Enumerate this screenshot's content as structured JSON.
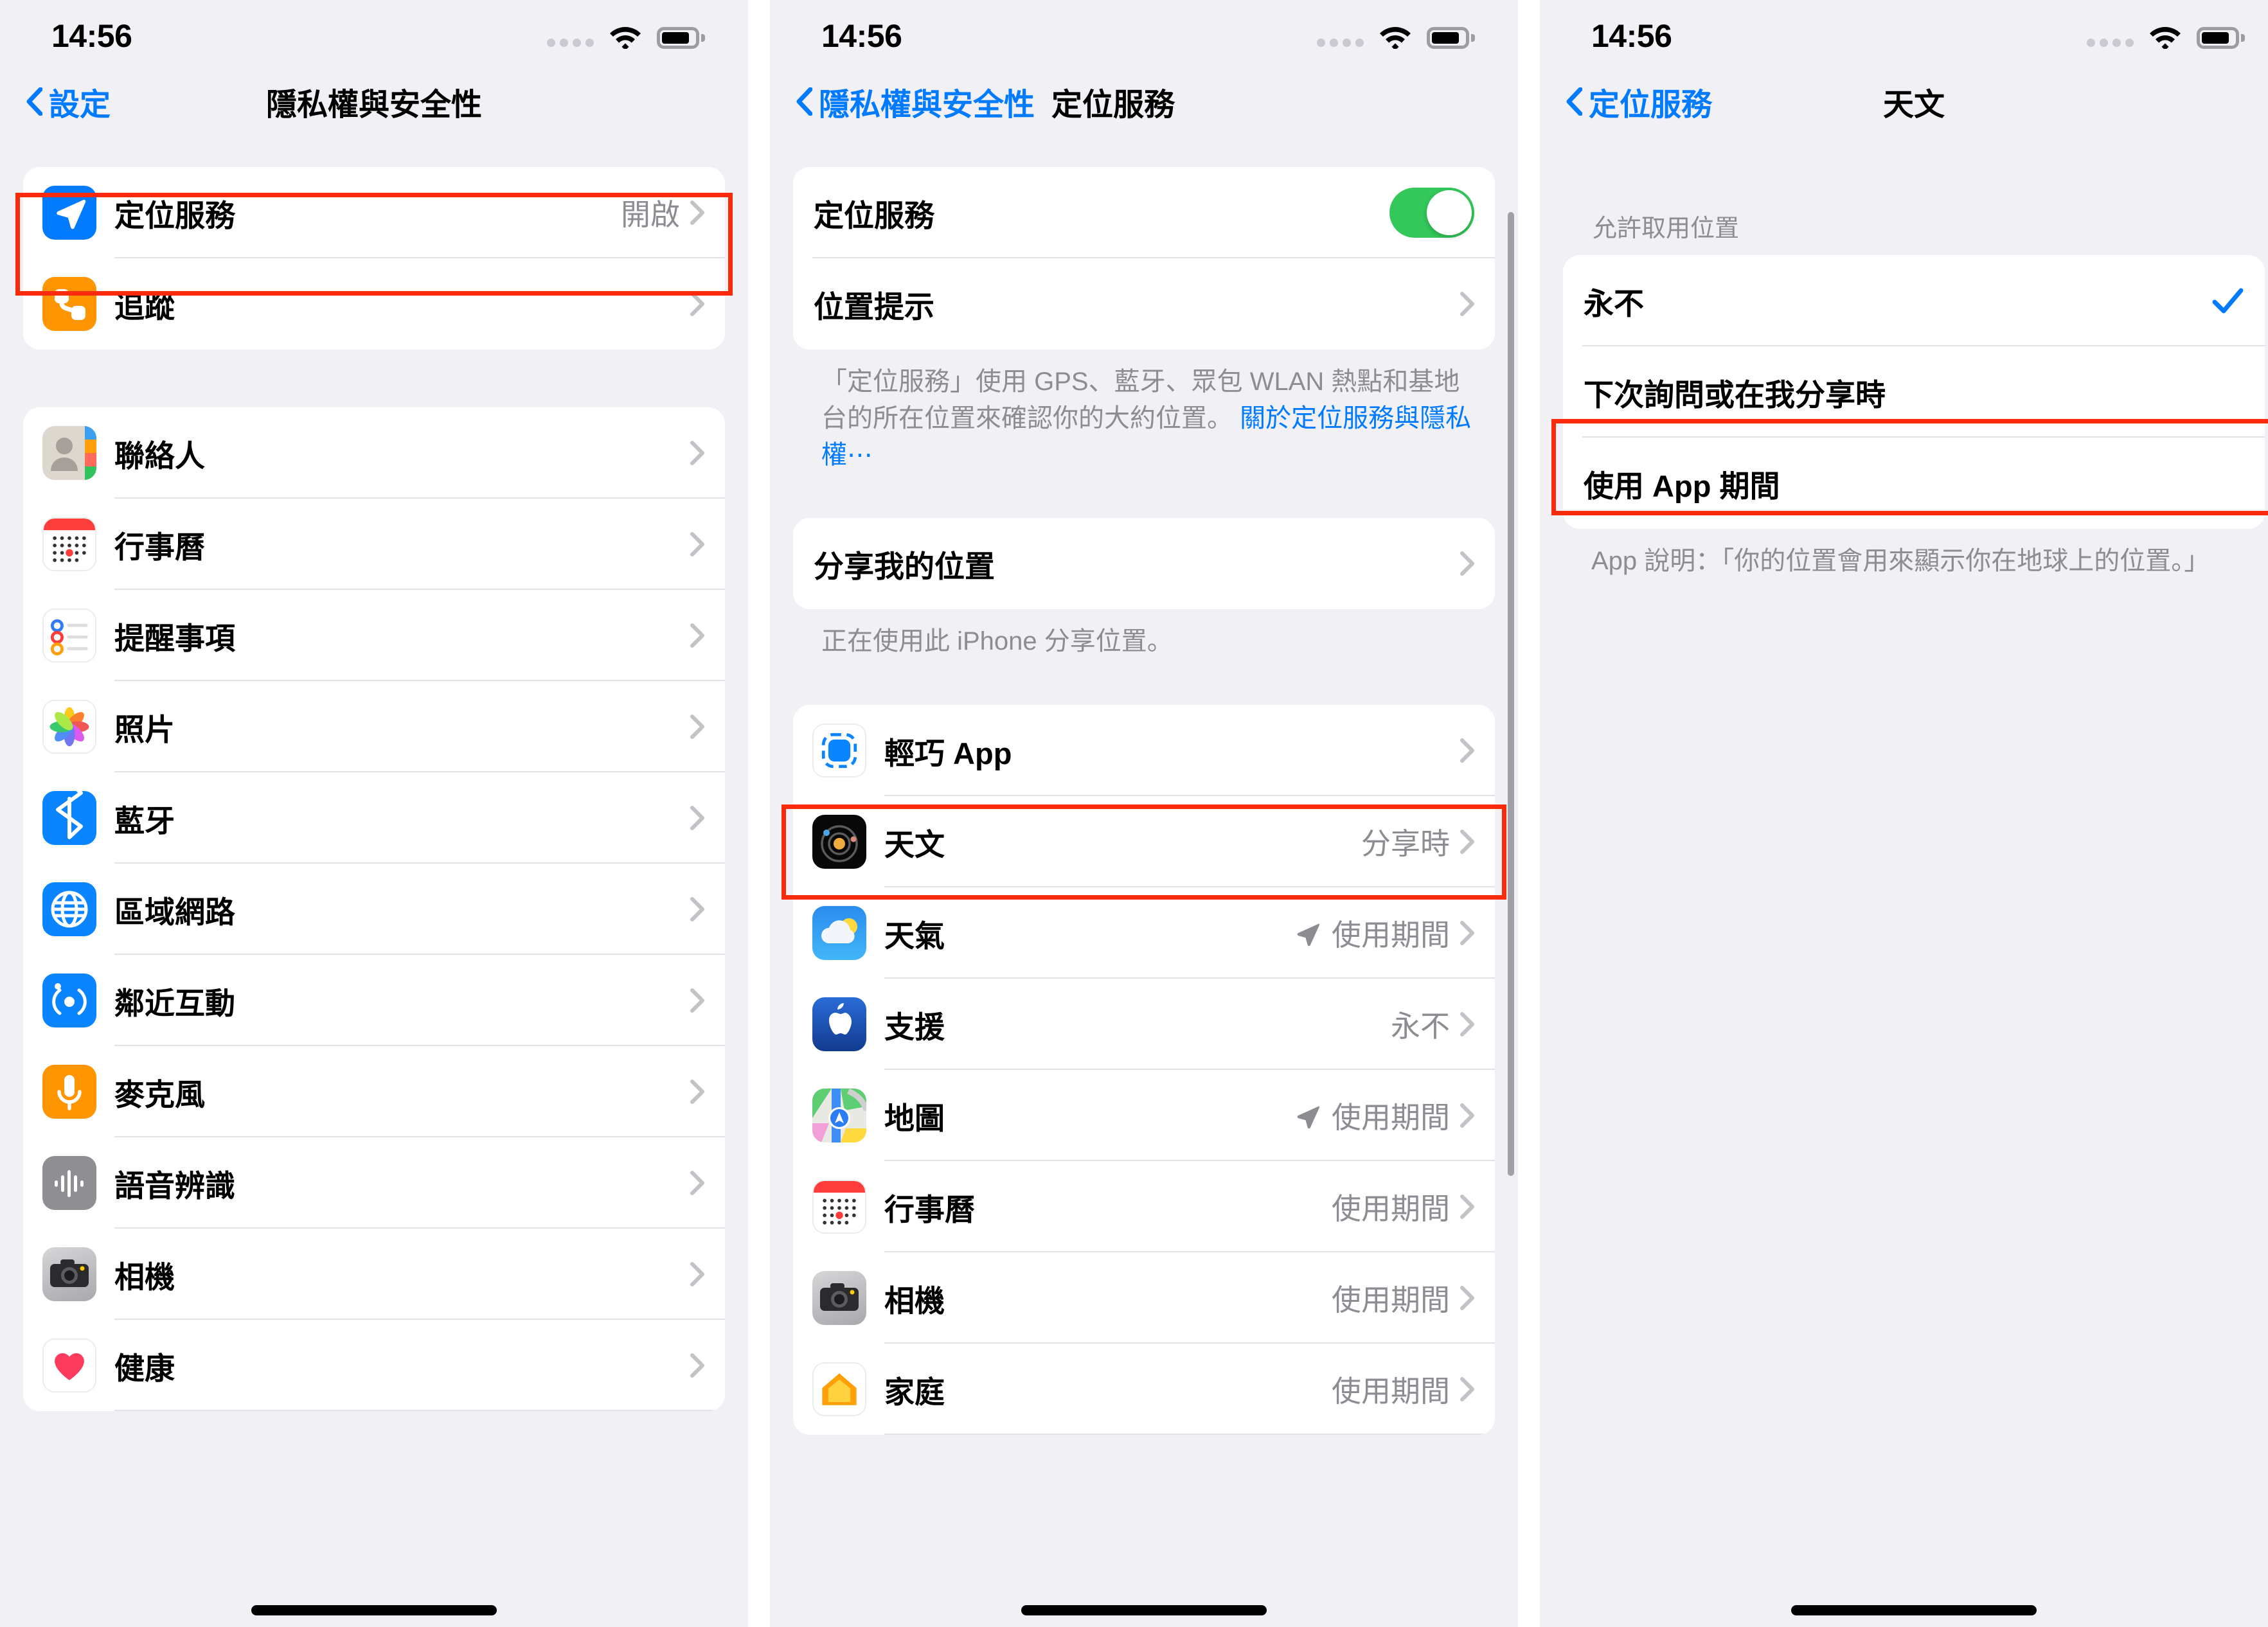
{
  "statusbar": {
    "time": "14:56"
  },
  "panel1": {
    "nav": {
      "back_label": "設定",
      "title": "隱私權與安全性"
    },
    "group_a": [
      {
        "label": "定位服務",
        "value": "開啟",
        "icon": "location-services-icon",
        "highlighted": true
      },
      {
        "label": "追蹤",
        "value": "",
        "icon": "tracking-icon",
        "highlighted": false
      }
    ],
    "group_b": [
      {
        "label": "聯絡人",
        "icon": "contacts-icon"
      },
      {
        "label": "行事曆",
        "icon": "calendar-icon"
      },
      {
        "label": "提醒事項",
        "icon": "reminders-icon"
      },
      {
        "label": "照片",
        "icon": "photos-icon"
      },
      {
        "label": "藍牙",
        "icon": "bluetooth-icon"
      },
      {
        "label": "區域網路",
        "icon": "local-network-icon"
      },
      {
        "label": "鄰近互動",
        "icon": "nearby-interactions-icon"
      },
      {
        "label": "麥克風",
        "icon": "microphone-icon"
      },
      {
        "label": "語音辨識",
        "icon": "speech-recognition-icon"
      },
      {
        "label": "相機",
        "icon": "camera-icon"
      },
      {
        "label": "健康",
        "icon": "health-icon"
      }
    ]
  },
  "panel2": {
    "nav": {
      "back_label": "隱私權與安全性",
      "title": "定位服務"
    },
    "group_a": [
      {
        "label": "定位服務",
        "control": "toggle",
        "toggle_on": true
      },
      {
        "label": "位置提示",
        "control": "chevron"
      }
    ],
    "footnote_text": "「定位服務」使用 GPS、藍牙、眾包 WLAN 熱點和基地台的所在位置來確認你的大約位置。 ",
    "footnote_link": "關於定位服務與隱私權⋯",
    "share_row": {
      "label": "分享我的位置"
    },
    "share_footnote": "正在使用此 iPhone 分享位置。",
    "apps": [
      {
        "label": "輕巧 App",
        "value": "",
        "arrow": false,
        "icon": "app-clips-icon",
        "highlighted": false
      },
      {
        "label": "天文",
        "value": "分享時",
        "arrow": false,
        "icon": "astronomy-icon",
        "highlighted": true
      },
      {
        "label": "天氣",
        "value": "使用期間",
        "arrow": true,
        "icon": "weather-icon",
        "highlighted": false
      },
      {
        "label": "支援",
        "value": "永不",
        "arrow": false,
        "icon": "support-icon",
        "highlighted": false
      },
      {
        "label": "地圖",
        "value": "使用期間",
        "arrow": true,
        "icon": "maps-icon",
        "highlighted": false
      },
      {
        "label": "行事曆",
        "value": "使用期間",
        "arrow": false,
        "icon": "calendar-icon",
        "highlighted": false
      },
      {
        "label": "相機",
        "value": "使用期間",
        "arrow": false,
        "icon": "camera-icon",
        "highlighted": false
      },
      {
        "label": "家庭",
        "value": "使用期間",
        "arrow": false,
        "icon": "home-icon",
        "highlighted": false
      }
    ]
  },
  "panel3": {
    "nav": {
      "back_label": "定位服務",
      "title": "天文"
    },
    "section_header": "允許取用位置",
    "options": [
      {
        "label": "永不",
        "selected": true,
        "highlighted": true
      },
      {
        "label": "下次詢問或在我分享時",
        "selected": false,
        "highlighted": false
      },
      {
        "label": "使用 App 期間",
        "selected": false,
        "highlighted": false
      }
    ],
    "footnote": "App 說明：「你的位置會用來顯示你在地球上的位置。」"
  },
  "colors": {
    "accent_blue": "#007aff",
    "toggle_green": "#34c759",
    "highlight_red": "#fa2b0c",
    "page_bg": "#f1f1f5",
    "card_bg": "#ffffff",
    "secondary_text": "#8c8c92"
  }
}
